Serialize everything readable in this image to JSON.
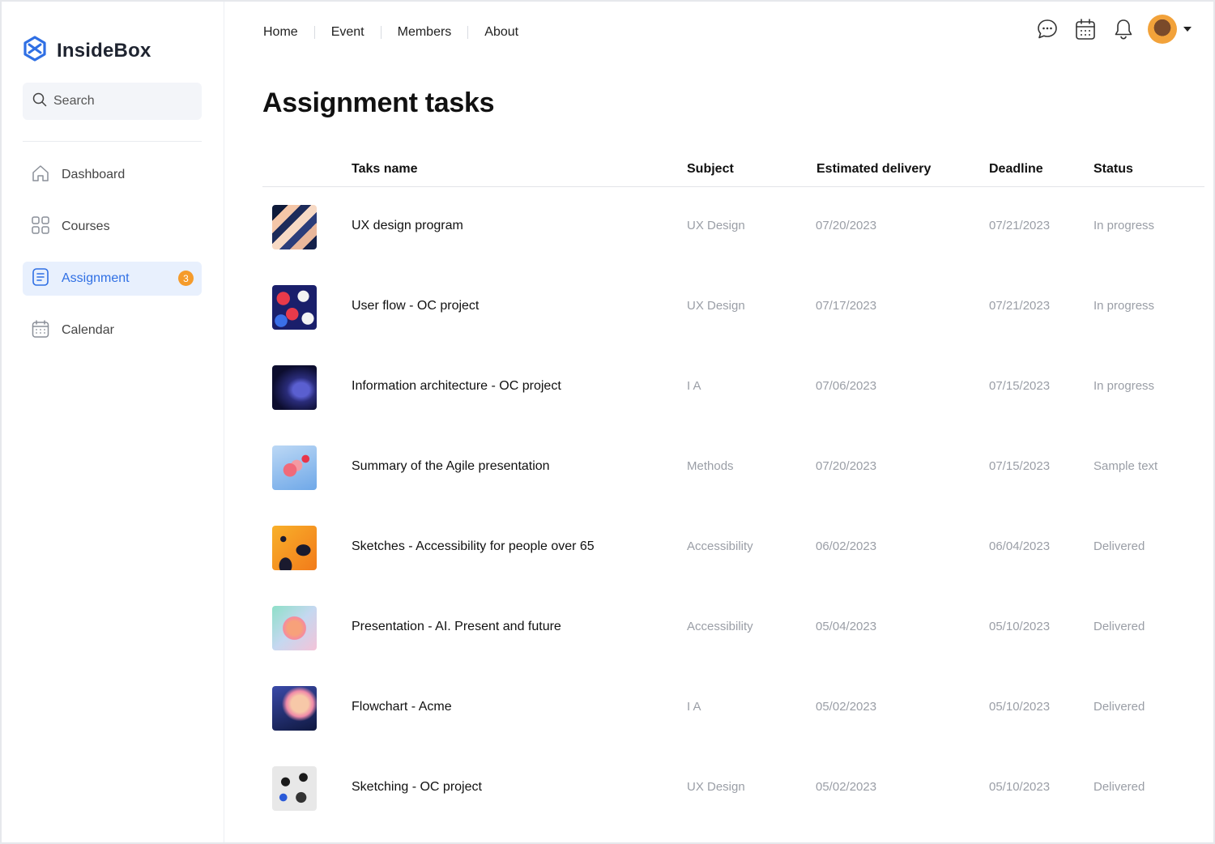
{
  "app": {
    "name": "InsideBox",
    "brand_color": "#2f6fe4"
  },
  "search": {
    "placeholder": "Search"
  },
  "sidebar": {
    "items": [
      {
        "label": "Dashboard",
        "icon": "home-icon",
        "active": false
      },
      {
        "label": "Courses",
        "icon": "grid-icon",
        "active": false
      },
      {
        "label": "Assignment",
        "icon": "document-icon",
        "active": true,
        "badge": "3"
      },
      {
        "label": "Calendar",
        "icon": "calendar-icon",
        "active": false
      }
    ]
  },
  "topnav": {
    "items": [
      "Home",
      "Event",
      "Members",
      "About"
    ]
  },
  "top_icons": [
    "chat-icon",
    "calendar-icon",
    "bell-icon",
    "avatar",
    "chevron-down-icon"
  ],
  "page": {
    "title": "Assignment tasks"
  },
  "table": {
    "columns": [
      "Taks name",
      "Subject",
      "Estimated delivery",
      "Deadline",
      "Status"
    ],
    "rows": [
      {
        "name": "UX design program",
        "subject": "UX Design",
        "estimated": "07/20/2023",
        "deadline": "07/21/2023",
        "status": "In progress",
        "thumb": "stripes"
      },
      {
        "name": "User flow - OC project",
        "subject": "UX Design",
        "estimated": "07/17/2023",
        "deadline": "07/21/2023",
        "status": "In progress",
        "thumb": "pattern"
      },
      {
        "name": "Information architecture - OC project",
        "subject": "I A",
        "estimated": "07/06/2023",
        "deadline": "07/15/2023",
        "status": "In progress",
        "thumb": "dark"
      },
      {
        "name": "Summary of the Agile presentation",
        "subject": "Methods",
        "estimated": "07/20/2023",
        "deadline": "07/15/2023",
        "status": "Sample text",
        "thumb": "knot"
      },
      {
        "name": "Sketches - Accessibility for people over 65",
        "subject": "Accessibility",
        "estimated": "06/02/2023",
        "deadline": "06/04/2023",
        "status": "Delivered",
        "thumb": "orange"
      },
      {
        "name": "Presentation - AI. Present and future",
        "subject": "Accessibility",
        "estimated": "05/04/2023",
        "deadline": "05/10/2023",
        "status": "Delivered",
        "thumb": "sphere"
      },
      {
        "name": "Flowchart - Acme",
        "subject": "I A",
        "estimated": "05/02/2023",
        "deadline": "05/10/2023",
        "status": "Delivered",
        "thumb": "cloud"
      },
      {
        "name": "Sketching - OC project",
        "subject": "UX Design",
        "estimated": "05/02/2023",
        "deadline": "05/10/2023",
        "status": "Delivered",
        "thumb": "sketch"
      }
    ]
  }
}
